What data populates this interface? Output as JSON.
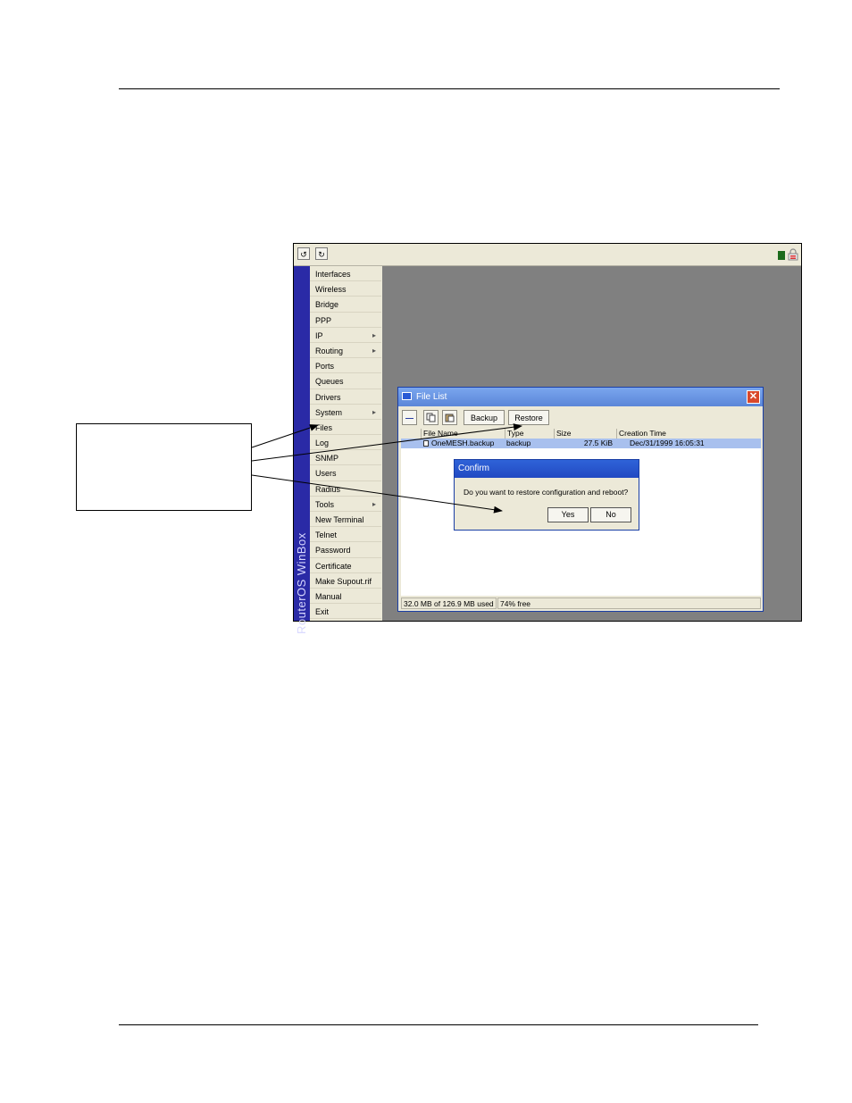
{
  "toolbar": {
    "undo_icon": "undo-icon",
    "redo_icon": "redo-icon"
  },
  "sidebar": {
    "brand": "RouterOS WinBox",
    "items": [
      {
        "label": "Interfaces",
        "arrow": ""
      },
      {
        "label": "Wireless",
        "arrow": ""
      },
      {
        "label": "Bridge",
        "arrow": ""
      },
      {
        "label": "PPP",
        "arrow": ""
      },
      {
        "label": "IP",
        "arrow": "▸"
      },
      {
        "label": "Routing",
        "arrow": "▸"
      },
      {
        "label": "Ports",
        "arrow": ""
      },
      {
        "label": "Queues",
        "arrow": ""
      },
      {
        "label": "Drivers",
        "arrow": ""
      },
      {
        "label": "System",
        "arrow": "▸"
      },
      {
        "label": "Files",
        "arrow": ""
      },
      {
        "label": "Log",
        "arrow": ""
      },
      {
        "label": "SNMP",
        "arrow": ""
      },
      {
        "label": "Users",
        "arrow": ""
      },
      {
        "label": "Radius",
        "arrow": ""
      },
      {
        "label": "Tools",
        "arrow": "▸"
      },
      {
        "label": "New Terminal",
        "arrow": ""
      },
      {
        "label": "Telnet",
        "arrow": ""
      },
      {
        "label": "Password",
        "arrow": ""
      },
      {
        "label": "Certificate",
        "arrow": ""
      },
      {
        "label": "Make Supout.rif",
        "arrow": ""
      },
      {
        "label": "Manual",
        "arrow": ""
      },
      {
        "label": "Exit",
        "arrow": ""
      }
    ]
  },
  "file_list": {
    "title": "File List",
    "close_label": "✕",
    "remove_label": "—",
    "backup_label": "Backup",
    "restore_label": "Restore",
    "columns": [
      "File Name",
      "Type",
      "Size",
      "Creation Time"
    ],
    "rows": [
      {
        "name": "OneMESH.backup",
        "type": "backup",
        "size": "27.5 KiB",
        "created": "Dec/31/1999 16:05:31"
      }
    ],
    "status_used": "32.0 MB of 126.9 MB used",
    "status_free": "74% free"
  },
  "confirm": {
    "title": "Confirm",
    "message": "Do you want to restore configuration and reboot?",
    "yes_label": "Yes",
    "no_label": "No"
  },
  "colors": {
    "sidebar_strip": "#2a2aa6",
    "workspace": "#808080",
    "titlebar": "#5b86d8",
    "selected_row": "#a8c0ee"
  }
}
